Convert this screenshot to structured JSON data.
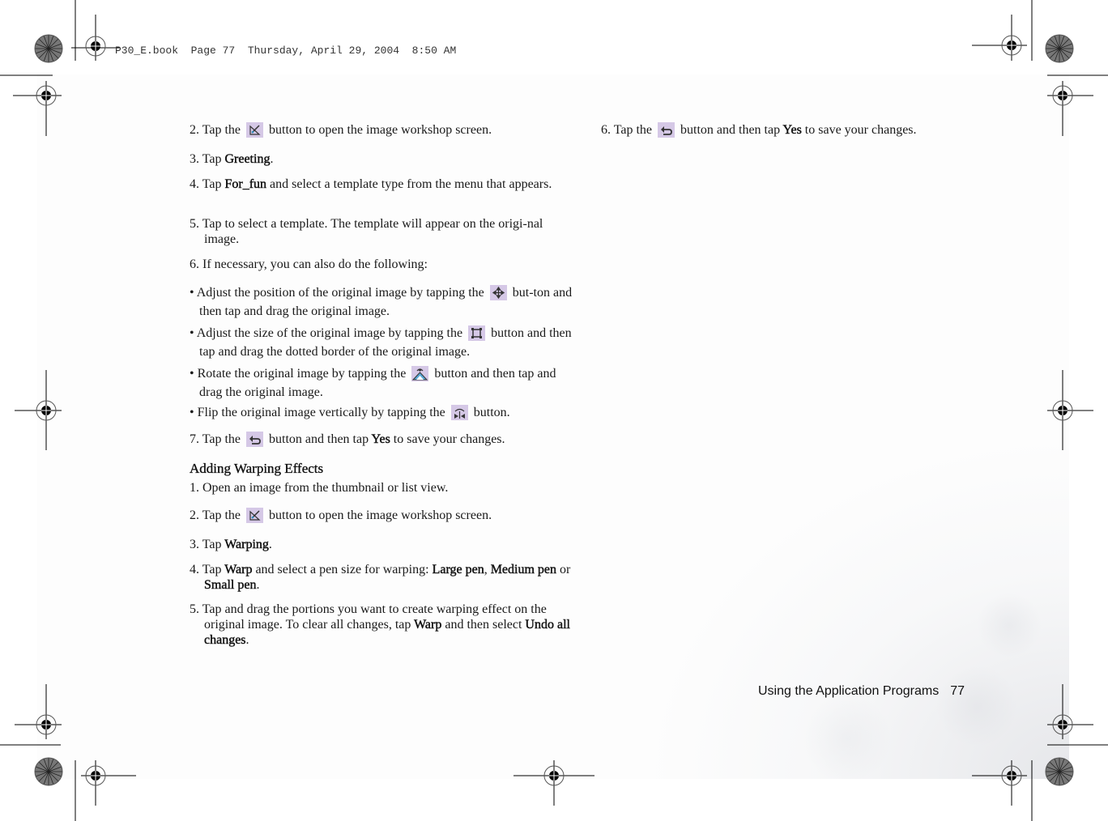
{
  "header": {
    "file_info": "P30_E.book  Page 77  Thursday, April 29, 2004  8:50 AM"
  },
  "left_column": {
    "step2": {
      "pre": "2. Tap the",
      "post": "button to open the image workshop screen.",
      "icon": "image-workshop-icon"
    },
    "step3": {
      "pre": "3. Tap ",
      "bold": "Greeting",
      "post": "."
    },
    "step4": {
      "pre": "4. Tap ",
      "bold": "For_fun",
      "post": " and select a template type from the menu that appears."
    },
    "step5": {
      "text": "5. Tap to select a template. The template will appear on the origi-nal image."
    },
    "step6": {
      "text": "6. If necessary, you can also do the following:"
    },
    "bullets": [
      {
        "pre": "• Adjust the position of the original image by tapping the",
        "post": "but-ton and then tap and drag the original image.",
        "icon": "move-icon"
      },
      {
        "pre": "• Adjust the size of the original image by tapping the",
        "post": "button and then tap and drag the dotted border of the original image.",
        "icon": "resize-icon"
      },
      {
        "pre": "• Rotate the original image by tapping the",
        "post": "button and then tap and drag the original image.",
        "icon": "rotate-icon"
      },
      {
        "pre": "• Flip the original image vertically by tapping the",
        "post": "button.",
        "icon": "flip-icon"
      }
    ],
    "step7": {
      "pre": "7. Tap the",
      "mid": "button and then tap ",
      "bold": "Yes",
      "post": " to save your changes.",
      "icon": "back-icon"
    },
    "section_heading": "Adding Warping Effects",
    "warp_steps": {
      "s1": "1. Open an image from the thumbnail or list view.",
      "s2": {
        "pre": "2. Tap the",
        "post": "button to open the image workshop screen.",
        "icon": "image-workshop-icon"
      },
      "s3": {
        "pre": "3. Tap ",
        "bold": "Warping",
        "post": "."
      },
      "s4": {
        "pre": "4. Tap ",
        "bold1": "Warp",
        "mid": " and select a pen size for warping: ",
        "bold2": "Large pen",
        "sep": ", ",
        "bold3": "Medium pen",
        "or": " or ",
        "bold4": "Small pen",
        "post": "."
      },
      "s5": {
        "pre": "5. Tap and drag the portions you want to create warping effect on the original image. To clear all changes, tap ",
        "bold1": "Warp",
        "mid": " and then select ",
        "bold2": "Undo all changes",
        "post": "."
      }
    }
  },
  "right_column": {
    "step6": {
      "pre": "6. Tap the",
      "mid": "button and then tap ",
      "bold": "Yes",
      "post": " to save your changes.",
      "icon": "back-icon"
    }
  },
  "footer": {
    "section_title": "Using the Application Programs",
    "page_number": "77"
  },
  "colors": {
    "icon_bg": "#d5c8e6",
    "text": "#1a1a1a"
  }
}
